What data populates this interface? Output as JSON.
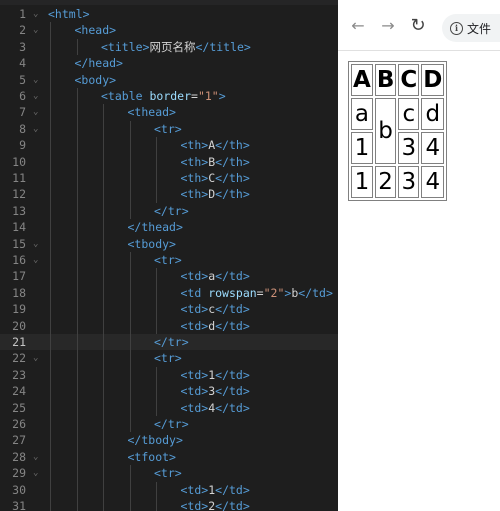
{
  "editor": {
    "lines": [
      {
        "n": "1",
        "indent": 0,
        "tokens": [
          [
            "tagc",
            "<html>"
          ]
        ]
      },
      {
        "n": "2",
        "indent": 1,
        "tokens": [
          [
            "tagc",
            "<head>"
          ]
        ]
      },
      {
        "n": "3",
        "indent": 2,
        "tokens": [
          [
            "tagc",
            "<title>"
          ],
          [
            "txt",
            "网页名称"
          ],
          [
            "tagc",
            "</title>"
          ]
        ]
      },
      {
        "n": "4",
        "indent": 1,
        "tokens": [
          [
            "tagc",
            "</head>"
          ]
        ]
      },
      {
        "n": "5",
        "indent": 1,
        "tokens": [
          [
            "tagc",
            "<body>"
          ]
        ]
      },
      {
        "n": "6",
        "indent": 2,
        "tokens": [
          [
            "tagc",
            "<table "
          ],
          [
            "attr",
            "border"
          ],
          [
            "txt",
            "="
          ],
          [
            "str",
            "\"1\""
          ],
          [
            "tagc",
            ">"
          ]
        ]
      },
      {
        "n": "7",
        "indent": 3,
        "tokens": [
          [
            "tagc",
            "<thead>"
          ]
        ]
      },
      {
        "n": "8",
        "indent": 4,
        "tokens": [
          [
            "tagc",
            "<tr>"
          ]
        ]
      },
      {
        "n": "9",
        "indent": 5,
        "tokens": [
          [
            "tagc",
            "<th>"
          ],
          [
            "txt",
            "A"
          ],
          [
            "tagc",
            "</th>"
          ]
        ]
      },
      {
        "n": "10",
        "indent": 5,
        "tokens": [
          [
            "tagc",
            "<th>"
          ],
          [
            "txt",
            "B"
          ],
          [
            "tagc",
            "</th>"
          ]
        ]
      },
      {
        "n": "11",
        "indent": 5,
        "tokens": [
          [
            "tagc",
            "<th>"
          ],
          [
            "txt",
            "C"
          ],
          [
            "tagc",
            "</th>"
          ]
        ]
      },
      {
        "n": "12",
        "indent": 5,
        "tokens": [
          [
            "tagc",
            "<th>"
          ],
          [
            "txt",
            "D"
          ],
          [
            "tagc",
            "</th>"
          ]
        ]
      },
      {
        "n": "13",
        "indent": 4,
        "tokens": [
          [
            "tagc",
            "</tr>"
          ]
        ]
      },
      {
        "n": "14",
        "indent": 3,
        "tokens": [
          [
            "tagc",
            "</thead>"
          ]
        ]
      },
      {
        "n": "15",
        "indent": 3,
        "tokens": [
          [
            "tagc",
            "<tbody>"
          ]
        ]
      },
      {
        "n": "16",
        "indent": 4,
        "tokens": [
          [
            "tagc",
            "<tr>"
          ]
        ]
      },
      {
        "n": "17",
        "indent": 5,
        "tokens": [
          [
            "tagc",
            "<td>"
          ],
          [
            "txt",
            "a"
          ],
          [
            "tagc",
            "</td>"
          ]
        ]
      },
      {
        "n": "18",
        "indent": 5,
        "tokens": [
          [
            "tagc",
            "<td "
          ],
          [
            "attr",
            "rowspan"
          ],
          [
            "txt",
            "="
          ],
          [
            "str",
            "\"2\""
          ],
          [
            "tagc",
            ">"
          ],
          [
            "txt",
            "b"
          ],
          [
            "tagc",
            "</td>"
          ]
        ]
      },
      {
        "n": "19",
        "indent": 5,
        "tokens": [
          [
            "tagc",
            "<td>"
          ],
          [
            "txt",
            "c"
          ],
          [
            "tagc",
            "</td>"
          ]
        ]
      },
      {
        "n": "20",
        "indent": 5,
        "tokens": [
          [
            "tagc",
            "<td>"
          ],
          [
            "txt",
            "d"
          ],
          [
            "tagc",
            "</td>"
          ]
        ]
      },
      {
        "n": "21",
        "indent": 4,
        "current": true,
        "tokens": [
          [
            "tagc",
            "</tr>"
          ]
        ]
      },
      {
        "n": "22",
        "indent": 4,
        "tokens": [
          [
            "tagc",
            "<tr>"
          ]
        ]
      },
      {
        "n": "23",
        "indent": 5,
        "tokens": [
          [
            "tagc",
            "<td>"
          ],
          [
            "txt",
            "1"
          ],
          [
            "tagc",
            "</td>"
          ]
        ]
      },
      {
        "n": "24",
        "indent": 5,
        "tokens": [
          [
            "tagc",
            "<td>"
          ],
          [
            "txt",
            "3"
          ],
          [
            "tagc",
            "</td>"
          ]
        ]
      },
      {
        "n": "25",
        "indent": 5,
        "tokens": [
          [
            "tagc",
            "<td>"
          ],
          [
            "txt",
            "4"
          ],
          [
            "tagc",
            "</td>"
          ]
        ]
      },
      {
        "n": "26",
        "indent": 4,
        "tokens": [
          [
            "tagc",
            "</tr>"
          ]
        ]
      },
      {
        "n": "27",
        "indent": 3,
        "tokens": [
          [
            "tagc",
            "</tbody>"
          ]
        ]
      },
      {
        "n": "28",
        "indent": 3,
        "tokens": [
          [
            "tagc",
            "<tfoot>"
          ]
        ]
      },
      {
        "n": "29",
        "indent": 4,
        "tokens": [
          [
            "tagc",
            "<tr>"
          ]
        ]
      },
      {
        "n": "30",
        "indent": 5,
        "tokens": [
          [
            "tagc",
            "<td>"
          ],
          [
            "txt",
            "1"
          ],
          [
            "tagc",
            "</td>"
          ]
        ]
      },
      {
        "n": "31",
        "indent": 5,
        "tokens": [
          [
            "tagc",
            "<td>"
          ],
          [
            "txt",
            "2"
          ],
          [
            "tagc",
            "</td>"
          ]
        ]
      }
    ],
    "fold_glyph": "⌄"
  },
  "browser": {
    "back_icon": "←",
    "forward_icon": "→",
    "reload_icon": "↻",
    "info_icon": "i",
    "address_text": "文件"
  },
  "rendered_table": {
    "header": [
      "A",
      "B",
      "C",
      "D"
    ],
    "row1": {
      "a": "a",
      "b": "b",
      "c": "c",
      "d": "d"
    },
    "row2": [
      "1",
      "3",
      "4"
    ],
    "foot": [
      "1",
      "2",
      "3",
      "4"
    ]
  },
  "colors": {
    "editor_bg": "#1e1e1e",
    "tag": "#569cd6",
    "attribute": "#9cdcfe",
    "string": "#ce9178",
    "text": "#d4d4d4",
    "line_number": "#858585"
  }
}
